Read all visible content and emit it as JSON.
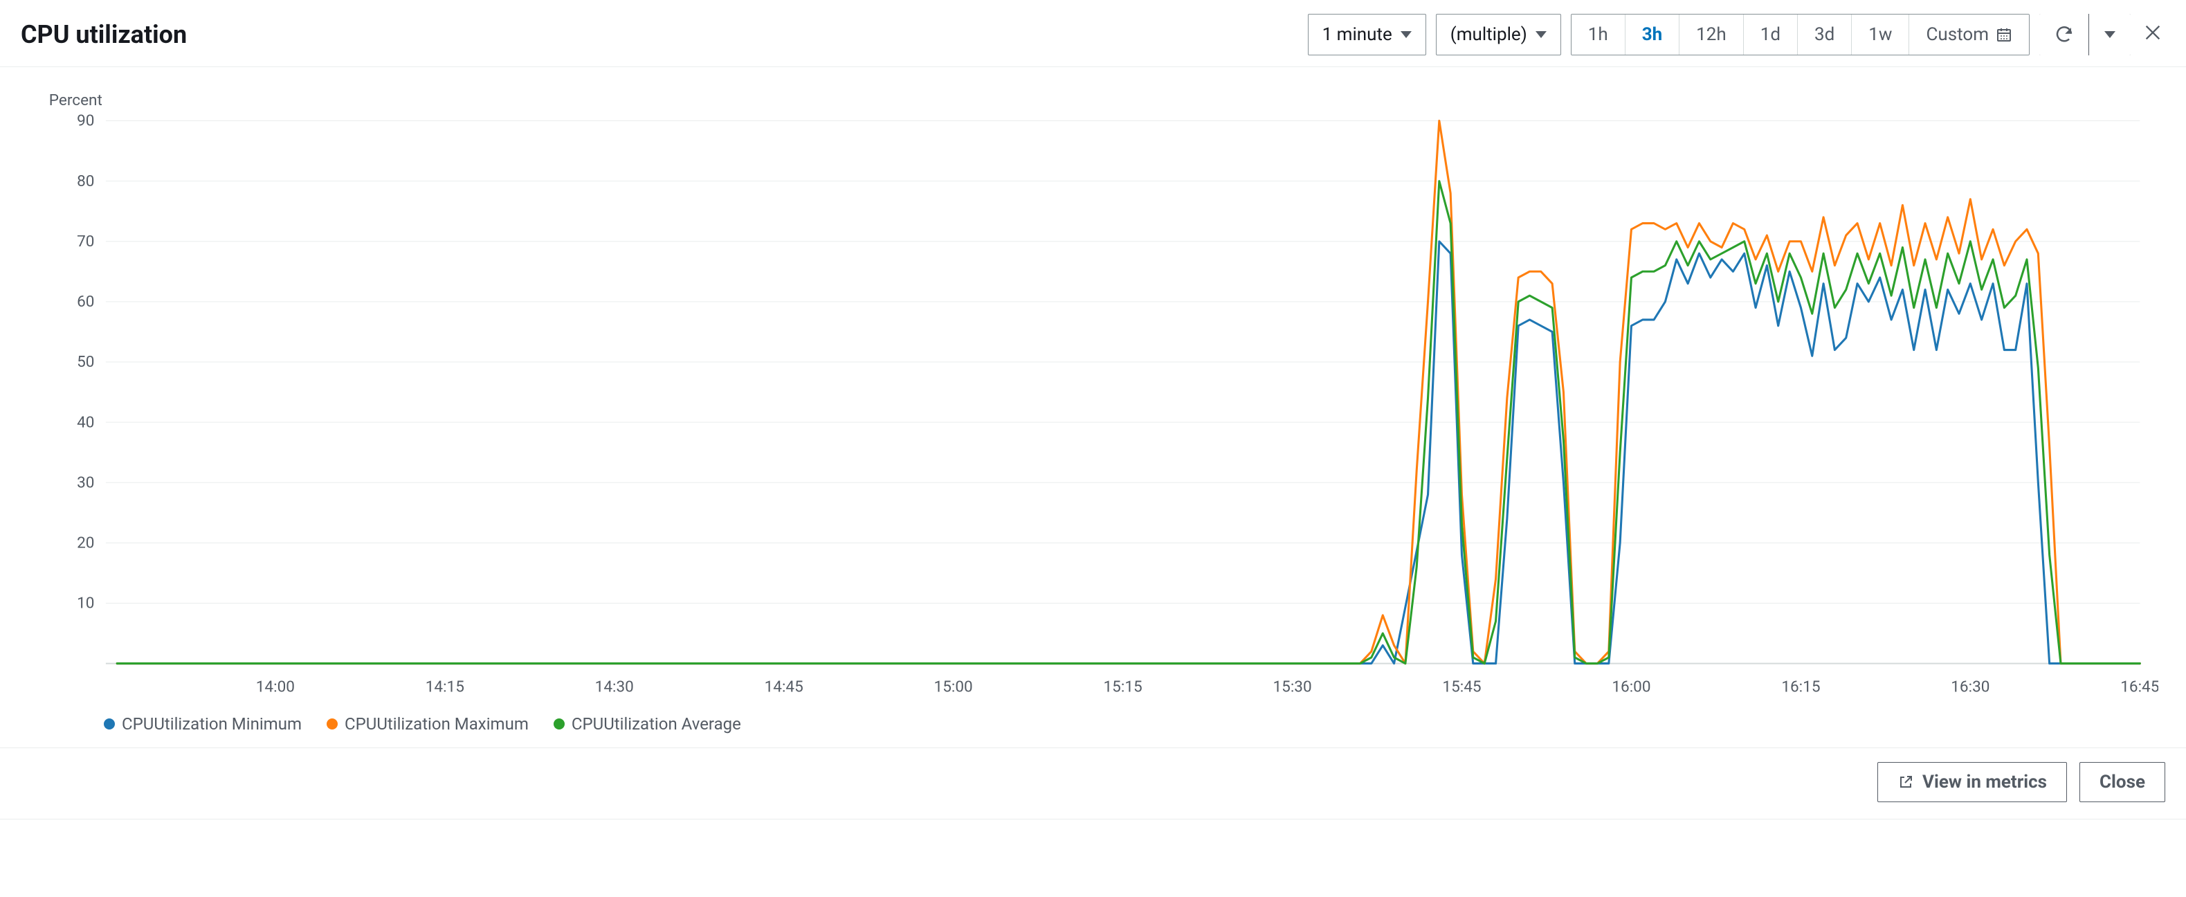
{
  "header": {
    "title": "CPU utilization",
    "period_dropdown": "1 minute",
    "stats_dropdown": "(multiple)",
    "time_ranges": [
      "1h",
      "3h",
      "12h",
      "1d",
      "3d",
      "1w"
    ],
    "active_range": "3h",
    "custom_label": "Custom"
  },
  "footer": {
    "view_metrics": "View in metrics",
    "close": "Close"
  },
  "colors": {
    "min": "#1f77b4",
    "max": "#ff7f0e",
    "avg": "#2ca02c"
  },
  "legend": [
    {
      "key": "min",
      "label": "CPUUtilization Minimum"
    },
    {
      "key": "max",
      "label": "CPUUtilization Maximum"
    },
    {
      "key": "avg",
      "label": "CPUUtilization Average"
    }
  ],
  "chart_data": {
    "type": "line",
    "title": "CPU utilization",
    "ylabel": "Percent",
    "xlabel": "",
    "ylim": [
      0,
      90
    ],
    "y_ticks": [
      10,
      20,
      30,
      40,
      50,
      60,
      70,
      80,
      90
    ],
    "x_range_minutes": [
      825,
      1005
    ],
    "x_ticks": [
      {
        "m": 840,
        "label": "14:00"
      },
      {
        "m": 855,
        "label": "14:15"
      },
      {
        "m": 870,
        "label": "14:30"
      },
      {
        "m": 885,
        "label": "14:45"
      },
      {
        "m": 900,
        "label": "15:00"
      },
      {
        "m": 915,
        "label": "15:15"
      },
      {
        "m": 930,
        "label": "15:30"
      },
      {
        "m": 945,
        "label": "15:45"
      },
      {
        "m": 960,
        "label": "16:00"
      },
      {
        "m": 975,
        "label": "16:15"
      },
      {
        "m": 990,
        "label": "16:30"
      },
      {
        "m": 1005,
        "label": "16:45"
      }
    ],
    "series": [
      {
        "name": "CPUUtilization Minimum",
        "colorKey": "min",
        "points": [
          {
            "m": 826,
            "v": 0
          },
          {
            "m": 937,
            "v": 0
          },
          {
            "m": 938,
            "v": 3
          },
          {
            "m": 939,
            "v": 0
          },
          {
            "m": 942,
            "v": 28
          },
          {
            "m": 943,
            "v": 70
          },
          {
            "m": 944,
            "v": 68
          },
          {
            "m": 945,
            "v": 18
          },
          {
            "m": 946,
            "v": 0
          },
          {
            "m": 947,
            "v": 0
          },
          {
            "m": 948,
            "v": 0
          },
          {
            "m": 949,
            "v": 24
          },
          {
            "m": 950,
            "v": 56
          },
          {
            "m": 951,
            "v": 57
          },
          {
            "m": 952,
            "v": 56
          },
          {
            "m": 953,
            "v": 55
          },
          {
            "m": 954,
            "v": 30
          },
          {
            "m": 955,
            "v": 0
          },
          {
            "m": 956,
            "v": 0
          },
          {
            "m": 957,
            "v": 0
          },
          {
            "m": 958,
            "v": 0
          },
          {
            "m": 959,
            "v": 20
          },
          {
            "m": 960,
            "v": 56
          },
          {
            "m": 961,
            "v": 57
          },
          {
            "m": 962,
            "v": 57
          },
          {
            "m": 963,
            "v": 60
          },
          {
            "m": 964,
            "v": 67
          },
          {
            "m": 965,
            "v": 63
          },
          {
            "m": 966,
            "v": 68
          },
          {
            "m": 967,
            "v": 64
          },
          {
            "m": 968,
            "v": 67
          },
          {
            "m": 969,
            "v": 65
          },
          {
            "m": 970,
            "v": 68
          },
          {
            "m": 971,
            "v": 59
          },
          {
            "m": 972,
            "v": 66
          },
          {
            "m": 973,
            "v": 56
          },
          {
            "m": 974,
            "v": 65
          },
          {
            "m": 975,
            "v": 59
          },
          {
            "m": 976,
            "v": 51
          },
          {
            "m": 977,
            "v": 63
          },
          {
            "m": 978,
            "v": 52
          },
          {
            "m": 979,
            "v": 54
          },
          {
            "m": 980,
            "v": 63
          },
          {
            "m": 981,
            "v": 60
          },
          {
            "m": 982,
            "v": 64
          },
          {
            "m": 983,
            "v": 57
          },
          {
            "m": 984,
            "v": 62
          },
          {
            "m": 985,
            "v": 52
          },
          {
            "m": 986,
            "v": 62
          },
          {
            "m": 987,
            "v": 52
          },
          {
            "m": 988,
            "v": 62
          },
          {
            "m": 989,
            "v": 58
          },
          {
            "m": 990,
            "v": 63
          },
          {
            "m": 991,
            "v": 57
          },
          {
            "m": 992,
            "v": 63
          },
          {
            "m": 993,
            "v": 52
          },
          {
            "m": 994,
            "v": 52
          },
          {
            "m": 995,
            "v": 63
          },
          {
            "m": 996,
            "v": 30
          },
          {
            "m": 997,
            "v": 0
          },
          {
            "m": 1005,
            "v": 0
          }
        ]
      },
      {
        "name": "CPUUtilization Maximum",
        "colorKey": "max",
        "points": [
          {
            "m": 826,
            "v": 0
          },
          {
            "m": 936,
            "v": 0
          },
          {
            "m": 937,
            "v": 2
          },
          {
            "m": 938,
            "v": 8
          },
          {
            "m": 939,
            "v": 3
          },
          {
            "m": 940,
            "v": 0
          },
          {
            "m": 941,
            "v": 32
          },
          {
            "m": 942,
            "v": 60
          },
          {
            "m": 943,
            "v": 90
          },
          {
            "m": 944,
            "v": 78
          },
          {
            "m": 945,
            "v": 28
          },
          {
            "m": 946,
            "v": 2
          },
          {
            "m": 947,
            "v": 0
          },
          {
            "m": 948,
            "v": 14
          },
          {
            "m": 949,
            "v": 44
          },
          {
            "m": 950,
            "v": 64
          },
          {
            "m": 951,
            "v": 65
          },
          {
            "m": 952,
            "v": 65
          },
          {
            "m": 953,
            "v": 63
          },
          {
            "m": 954,
            "v": 45
          },
          {
            "m": 955,
            "v": 2
          },
          {
            "m": 956,
            "v": 0
          },
          {
            "m": 957,
            "v": 0
          },
          {
            "m": 958,
            "v": 2
          },
          {
            "m": 959,
            "v": 50
          },
          {
            "m": 960,
            "v": 72
          },
          {
            "m": 961,
            "v": 73
          },
          {
            "m": 962,
            "v": 73
          },
          {
            "m": 963,
            "v": 72
          },
          {
            "m": 964,
            "v": 73
          },
          {
            "m": 965,
            "v": 69
          },
          {
            "m": 966,
            "v": 73
          },
          {
            "m": 967,
            "v": 70
          },
          {
            "m": 968,
            "v": 69
          },
          {
            "m": 969,
            "v": 73
          },
          {
            "m": 970,
            "v": 72
          },
          {
            "m": 971,
            "v": 67
          },
          {
            "m": 972,
            "v": 71
          },
          {
            "m": 973,
            "v": 65
          },
          {
            "m": 974,
            "v": 70
          },
          {
            "m": 975,
            "v": 70
          },
          {
            "m": 976,
            "v": 65
          },
          {
            "m": 977,
            "v": 74
          },
          {
            "m": 978,
            "v": 66
          },
          {
            "m": 979,
            "v": 71
          },
          {
            "m": 980,
            "v": 73
          },
          {
            "m": 981,
            "v": 67
          },
          {
            "m": 982,
            "v": 73
          },
          {
            "m": 983,
            "v": 66
          },
          {
            "m": 984,
            "v": 76
          },
          {
            "m": 985,
            "v": 66
          },
          {
            "m": 986,
            "v": 73
          },
          {
            "m": 987,
            "v": 67
          },
          {
            "m": 988,
            "v": 74
          },
          {
            "m": 989,
            "v": 68
          },
          {
            "m": 990,
            "v": 77
          },
          {
            "m": 991,
            "v": 67
          },
          {
            "m": 992,
            "v": 72
          },
          {
            "m": 993,
            "v": 66
          },
          {
            "m": 994,
            "v": 70
          },
          {
            "m": 995,
            "v": 72
          },
          {
            "m": 996,
            "v": 68
          },
          {
            "m": 997,
            "v": 36
          },
          {
            "m": 998,
            "v": 0
          },
          {
            "m": 1005,
            "v": 0
          }
        ]
      },
      {
        "name": "CPUUtilization Average",
        "colorKey": "avg",
        "points": [
          {
            "m": 826,
            "v": 0
          },
          {
            "m": 936,
            "v": 0
          },
          {
            "m": 937,
            "v": 1
          },
          {
            "m": 938,
            "v": 5
          },
          {
            "m": 939,
            "v": 1
          },
          {
            "m": 940,
            "v": 0
          },
          {
            "m": 941,
            "v": 16
          },
          {
            "m": 942,
            "v": 44
          },
          {
            "m": 943,
            "v": 80
          },
          {
            "m": 944,
            "v": 73
          },
          {
            "m": 945,
            "v": 23
          },
          {
            "m": 946,
            "v": 1
          },
          {
            "m": 947,
            "v": 0
          },
          {
            "m": 948,
            "v": 7
          },
          {
            "m": 949,
            "v": 34
          },
          {
            "m": 950,
            "v": 60
          },
          {
            "m": 951,
            "v": 61
          },
          {
            "m": 952,
            "v": 60
          },
          {
            "m": 953,
            "v": 59
          },
          {
            "m": 954,
            "v": 37
          },
          {
            "m": 955,
            "v": 1
          },
          {
            "m": 956,
            "v": 0
          },
          {
            "m": 957,
            "v": 0
          },
          {
            "m": 958,
            "v": 1
          },
          {
            "m": 959,
            "v": 35
          },
          {
            "m": 960,
            "v": 64
          },
          {
            "m": 961,
            "v": 65
          },
          {
            "m": 962,
            "v": 65
          },
          {
            "m": 963,
            "v": 66
          },
          {
            "m": 964,
            "v": 70
          },
          {
            "m": 965,
            "v": 66
          },
          {
            "m": 966,
            "v": 70
          },
          {
            "m": 967,
            "v": 67
          },
          {
            "m": 968,
            "v": 68
          },
          {
            "m": 969,
            "v": 69
          },
          {
            "m": 970,
            "v": 70
          },
          {
            "m": 971,
            "v": 63
          },
          {
            "m": 972,
            "v": 68
          },
          {
            "m": 973,
            "v": 60
          },
          {
            "m": 974,
            "v": 68
          },
          {
            "m": 975,
            "v": 64
          },
          {
            "m": 976,
            "v": 58
          },
          {
            "m": 977,
            "v": 68
          },
          {
            "m": 978,
            "v": 59
          },
          {
            "m": 979,
            "v": 62
          },
          {
            "m": 980,
            "v": 68
          },
          {
            "m": 981,
            "v": 63
          },
          {
            "m": 982,
            "v": 68
          },
          {
            "m": 983,
            "v": 61
          },
          {
            "m": 984,
            "v": 69
          },
          {
            "m": 985,
            "v": 59
          },
          {
            "m": 986,
            "v": 67
          },
          {
            "m": 987,
            "v": 59
          },
          {
            "m": 988,
            "v": 68
          },
          {
            "m": 989,
            "v": 63
          },
          {
            "m": 990,
            "v": 70
          },
          {
            "m": 991,
            "v": 62
          },
          {
            "m": 992,
            "v": 67
          },
          {
            "m": 993,
            "v": 59
          },
          {
            "m": 994,
            "v": 61
          },
          {
            "m": 995,
            "v": 67
          },
          {
            "m": 996,
            "v": 49
          },
          {
            "m": 997,
            "v": 18
          },
          {
            "m": 998,
            "v": 0
          },
          {
            "m": 1005,
            "v": 0
          }
        ]
      }
    ]
  }
}
